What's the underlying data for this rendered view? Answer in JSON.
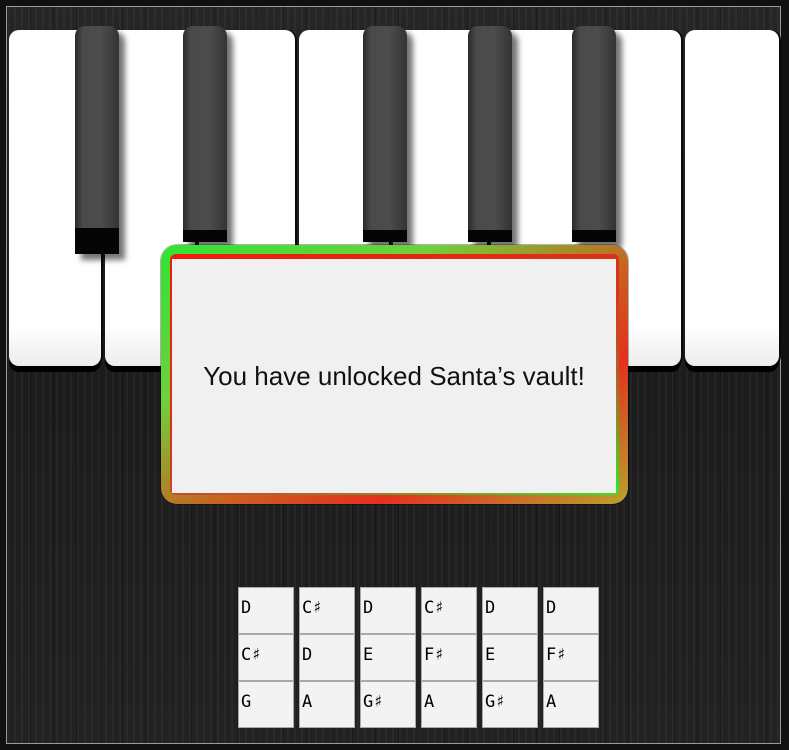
{
  "popup": {
    "message": "You have unlocked Santa’s vault!"
  },
  "keyboard": {
    "white_keys": [
      "white-key-1",
      "white-key-2",
      "white-key-3",
      "white-key-4",
      "white-key-5",
      "white-key-6",
      "white-key-7"
    ],
    "black_keys": [
      "black-key-1",
      "black-key-2",
      "black-key-3",
      "black-key-4",
      "black-key-5"
    ],
    "pressed_black_key": "black-key-1"
  },
  "note_table": {
    "rows": [
      [
        "D",
        "C♯",
        "D",
        "C♯",
        "D",
        "D"
      ],
      [
        "C♯",
        "D",
        "E",
        "F♯",
        "E",
        "F♯"
      ],
      [
        "G",
        "A",
        "G♯",
        "A",
        "G♯",
        "A"
      ]
    ]
  },
  "colors": {
    "border_green": "#2fe52f",
    "border_red": "#f21a10",
    "border_gold": "#b8a22c"
  }
}
